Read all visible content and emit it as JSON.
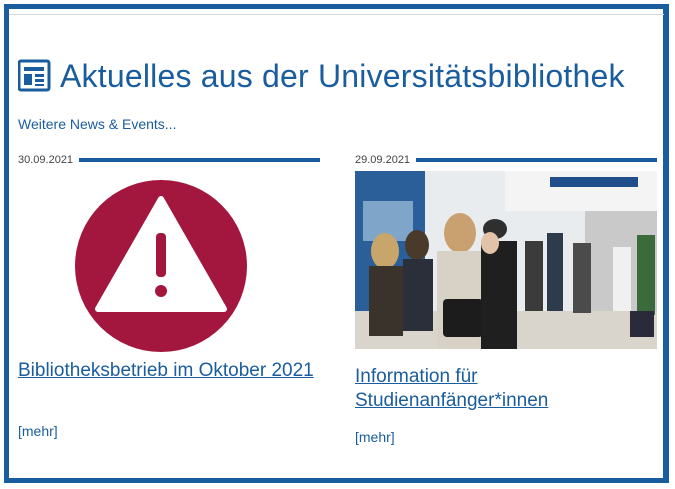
{
  "section": {
    "title": "Aktuelles aus der Universitätsbibliothek",
    "icon": "newspaper-icon",
    "more_link": "Weitere News & Events...",
    "accent_color": "#1a5d9e"
  },
  "news": [
    {
      "date": "30.09.2021",
      "image": "warning-icon",
      "image_color": "#a3173f",
      "title": "Bibliotheksbetrieb im Oktober 2021",
      "more": "[mehr]"
    },
    {
      "date": "29.09.2021",
      "image": "students-in-library-foyer-photo",
      "title": "Information für Studienanfänger*innen",
      "more": "[mehr]"
    }
  ]
}
